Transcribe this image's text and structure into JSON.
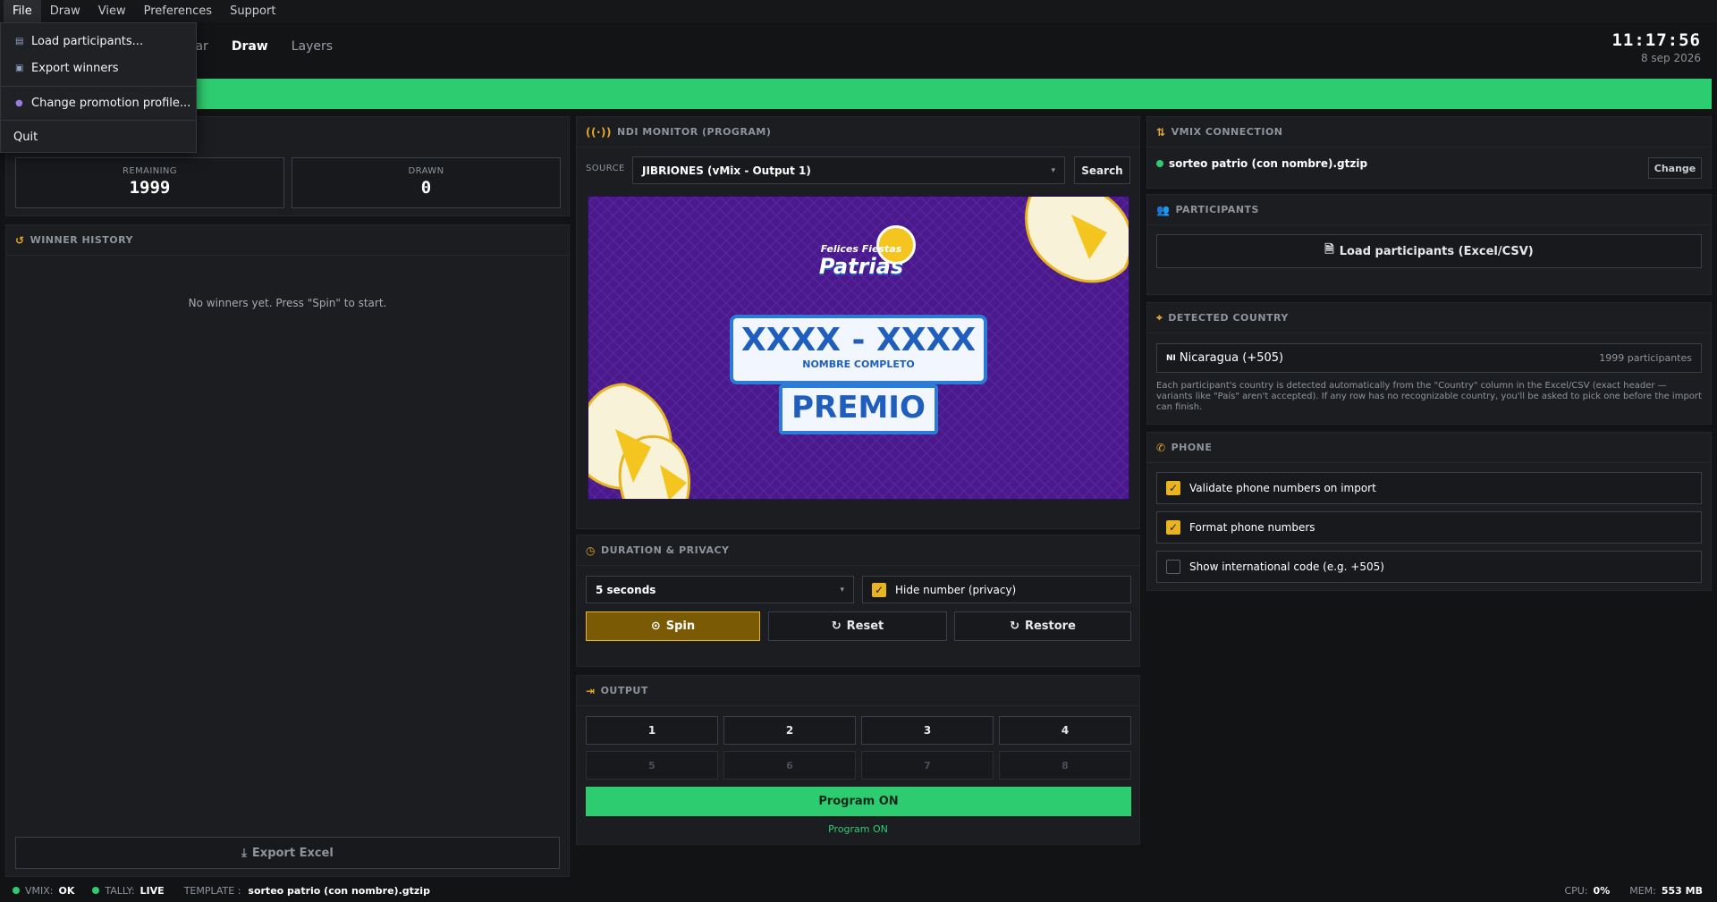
{
  "menu": {
    "file": "File",
    "draw": "Draw",
    "view": "View",
    "preferences": "Preferences",
    "support": "Support"
  },
  "file_menu": {
    "load": "Load participants...",
    "export": "Export winners",
    "change_profile": "Change promotion profile...",
    "quit": "Quit"
  },
  "tabs": {
    "iniciar": "Iniciar",
    "draw": "Draw",
    "layers": "Layers"
  },
  "clock": {
    "time": "11:17:56",
    "date": "8 sep 2026"
  },
  "stats": {
    "remaining_label": "REMAINING",
    "remaining": "1999",
    "drawn_label": "DRAWN",
    "drawn": "0"
  },
  "history": {
    "title": "WINNER HISTORY",
    "empty": "No winners yet. Press \"Spin\" to start.",
    "export": "Export Excel"
  },
  "ndi": {
    "title": "NDI MONITOR (PROGRAM)",
    "source_label": "SOURCE",
    "source": "JIBRIONES (vMix - Output 1)",
    "search": "Search"
  },
  "preview": {
    "logo_top": "Felices Fiestas",
    "logo_main": "Patrias",
    "number": "XXXX - XXXX",
    "name": "NOMBRE COMPLETO",
    "prize": "PREMIO"
  },
  "duration": {
    "title": "DURATION & PRIVACY",
    "value": "5 seconds",
    "hide": "Hide number (privacy)",
    "spin": "Spin",
    "reset": "Reset",
    "restore": "Restore"
  },
  "output": {
    "title": "OUTPUT",
    "buttons": [
      "1",
      "2",
      "3",
      "4"
    ],
    "disabled": [
      "5",
      "6",
      "7",
      "8"
    ],
    "program": "Program ON",
    "status": "Program ON"
  },
  "vmix": {
    "title": "VMIX CONNECTION",
    "file": "sorteo patrio (con nombre).gtzip",
    "change": "Change"
  },
  "participants": {
    "title": "PARTICIPANTS",
    "load": "Load participants (Excel/CSV)"
  },
  "country": {
    "title": "DETECTED COUNTRY",
    "flag": "NI",
    "name": "Nicaragua (+505)",
    "count": "1999 participantes",
    "note": "Each participant's country is detected automatically from the \"Country\" column in the Excel/CSV (exact header — variants like \"País\" aren't accepted). If any row has no recognizable country, you'll be asked to pick one before the import can finish."
  },
  "phone": {
    "title": "PHONE",
    "validate": "Validate phone numbers on import",
    "format": "Format phone numbers",
    "intl": "Show international code (e.g. +505)"
  },
  "status": {
    "vmix_label": "VMIX:",
    "vmix": "OK",
    "tally_label": "TALLY:",
    "tally": "LIVE",
    "template_label": "TEMPLATE :",
    "template": "sorteo patrio (con nombre).gtzip",
    "cpu_label": "CPU:",
    "cpu": "0%",
    "mem_label": "MEM:",
    "mem": "553 MB"
  },
  "colors": {
    "accent": "#e8b422",
    "green": "#2ecc71",
    "purple": "#4a1a8c"
  }
}
